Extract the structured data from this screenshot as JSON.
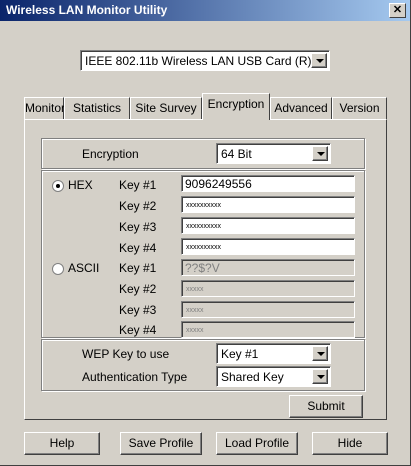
{
  "window": {
    "title": "Wireless LAN Monitor Utility",
    "close_icon": "close-icon"
  },
  "adapter": {
    "selected": "IEEE 802.11b Wireless LAN USB Card (R)"
  },
  "tabs": [
    {
      "label": "Monitor"
    },
    {
      "label": "Statistics"
    },
    {
      "label": "Site Survey"
    },
    {
      "label": "Encryption",
      "active": true
    },
    {
      "label": "Advanced"
    },
    {
      "label": "Version"
    }
  ],
  "encryption": {
    "label": "Encryption",
    "selected": "64 Bit",
    "hex": {
      "label": "HEX",
      "selected": true,
      "keys": [
        {
          "label": "Key #1",
          "value": "9096249556"
        },
        {
          "label": "Key #2",
          "value": "xxxxxxxxxx"
        },
        {
          "label": "Key #3",
          "value": "xxxxxxxxxx"
        },
        {
          "label": "Key #4",
          "value": "xxxxxxxxxx"
        }
      ]
    },
    "ascii": {
      "label": "ASCII",
      "selected": false,
      "keys": [
        {
          "label": "Key #1",
          "value": "??$?V"
        },
        {
          "label": "Key #2",
          "value": "xxxxx"
        },
        {
          "label": "Key #3",
          "value": "xxxxx"
        },
        {
          "label": "Key #4",
          "value": "xxxxx"
        }
      ]
    },
    "wep_key": {
      "label": "WEP Key to use",
      "selected": "Key #1"
    },
    "auth": {
      "label": "Authentication Type",
      "selected": "Shared Key"
    },
    "submit_label": "Submit"
  },
  "footer": {
    "help_label": "Help",
    "save_label": "Save Profile",
    "load_label": "Load Profile",
    "hide_label": "Hide"
  }
}
